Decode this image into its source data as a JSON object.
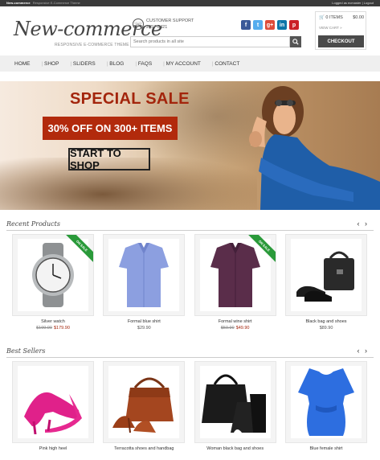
{
  "topbar": {
    "site": "New-commerce",
    "tagline": "Responsive E-Commerce Theme",
    "login_text": "Logged as ecmaster",
    "logout": "Logout"
  },
  "header": {
    "logo": "New-commerce",
    "tagline": "RESPONSIVE E-COMMERCE THEME",
    "support_label": "CUSTOMER SUPPORT",
    "support_phone": "2357-8421",
    "social": [
      {
        "name": "facebook-icon",
        "glyph": "f",
        "color": "#3b5998"
      },
      {
        "name": "twitter-icon",
        "glyph": "t",
        "color": "#55acee"
      },
      {
        "name": "google-plus-icon",
        "glyph": "g+",
        "color": "#dd4b39"
      },
      {
        "name": "linkedin-icon",
        "glyph": "in",
        "color": "#0e76a8"
      },
      {
        "name": "pinterest-icon",
        "glyph": "p",
        "color": "#cb2027"
      }
    ],
    "search_placeholder": "Search products in all site"
  },
  "cart": {
    "items": "0 ITEMS",
    "total": "$0.00",
    "view_cart": "VIEW CART",
    "checkout": "CHECKOUT"
  },
  "nav": [
    "HOME",
    "SHOP",
    "SLIDERS",
    "BLOG",
    "FAQS",
    "MY ACCOUNT",
    "CONTACT"
  ],
  "hero": {
    "title": "SPECIAL SALE",
    "offer": "30% OFF ON 300+ ITEMS",
    "cta": "START TO SHOP"
  },
  "recent": {
    "title": "Recent Products",
    "products": [
      {
        "name": "Silver watch",
        "old_price": "$199.90",
        "price": "$179.90",
        "badge": "ON SALE",
        "icon": "watch-image"
      },
      {
        "name": "Formal blue shirt",
        "old_price": "",
        "price": "$29.90",
        "badge": "",
        "icon": "blue-shirt-image"
      },
      {
        "name": "Formal wine shirt",
        "old_price": "$59.90",
        "price": "$49.90",
        "badge": "ON SALE",
        "icon": "wine-shirt-image"
      },
      {
        "name": "Black bag and shoes",
        "old_price": "",
        "price": "$89.90",
        "badge": "",
        "icon": "bag-and-shoes-image"
      }
    ]
  },
  "best": {
    "title": "Best Sellers",
    "products": [
      {
        "name": "Pink high heel",
        "icon": "pink-heel-image"
      },
      {
        "name": "Terracotta shoes and handbag",
        "icon": "terracotta-bag-image"
      },
      {
        "name": "Woman black bag and shoes",
        "icon": "black-bag-image"
      },
      {
        "name": "Blue female shirt",
        "icon": "blue-blouse-image"
      }
    ]
  },
  "colors": {
    "accent_red": "#b22a0c",
    "sale_green": "#2a9a3a",
    "dark": "#4a4a4a"
  }
}
